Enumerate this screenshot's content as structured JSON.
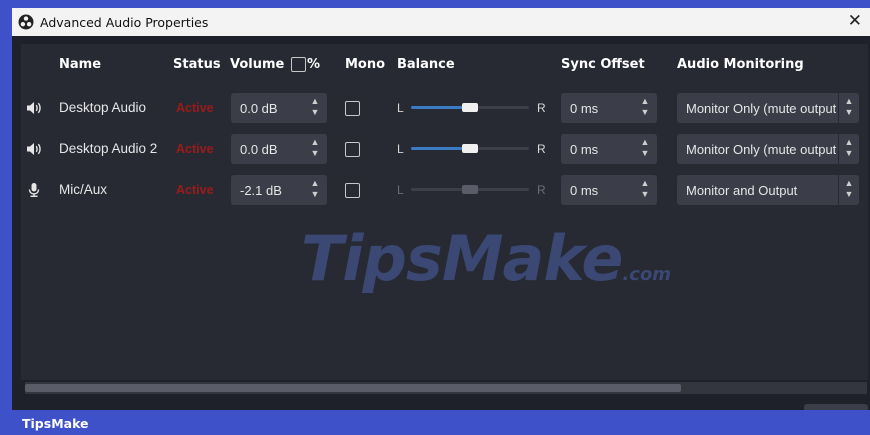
{
  "window": {
    "title": "Advanced Audio Properties",
    "close_glyph": "✕"
  },
  "columns": {
    "name": "Name",
    "status": "Status",
    "volume": "Volume",
    "volume_percent": "%",
    "mono": "Mono",
    "balance": "Balance",
    "sync_offset": "Sync Offset",
    "audio_monitoring": "Audio Monitoring"
  },
  "rows": [
    {
      "icon": "speaker-icon",
      "name": "Desktop Audio",
      "status": "Active",
      "volume": "0.0 dB",
      "mono": false,
      "balance_left": "L",
      "balance_right": "R",
      "balance": 0.5,
      "sync_offset": "0 ms",
      "monitoring": "Monitor Only (mute output)"
    },
    {
      "icon": "speaker-icon",
      "name": "Desktop Audio 2",
      "status": "Active",
      "volume": "0.0 dB",
      "mono": false,
      "balance_left": "L",
      "balance_right": "R",
      "balance": 0.5,
      "sync_offset": "0 ms",
      "monitoring": "Monitor Only (mute output)"
    },
    {
      "icon": "microphone-icon",
      "name": "Mic/Aux",
      "status": "Active",
      "volume": "-2.1 dB",
      "mono": false,
      "balance_left": "L",
      "balance_right": "R",
      "balance": 0.5,
      "sync_offset": "0 ms",
      "monitoring": "Monitor and Output"
    }
  ],
  "watermark": {
    "main": "TipsMake",
    "suffix": ".com"
  },
  "footer": {
    "label": "TipsMake"
  },
  "colors": {
    "frame": "#3f51c8",
    "background": "#1f212a",
    "panel": "#272a33",
    "status_active": "#9b1b1b",
    "slider_fill": "#3c7cc4"
  }
}
